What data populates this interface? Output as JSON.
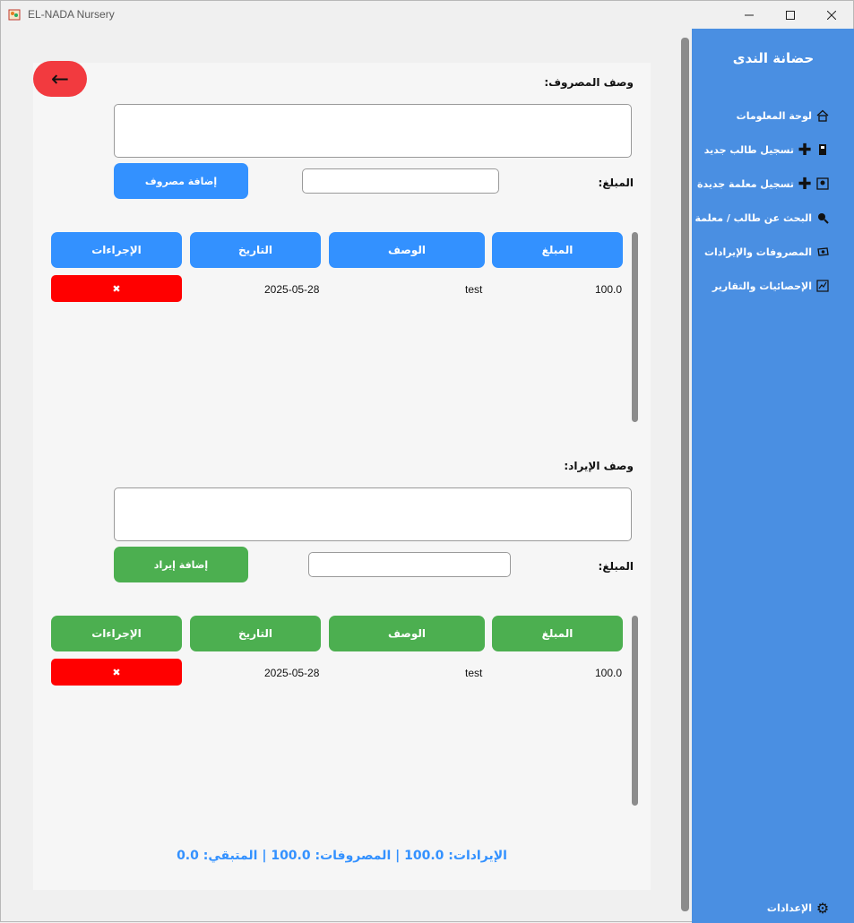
{
  "window": {
    "title": "EL-NADA Nursery"
  },
  "sidebar": {
    "title": "حضانة الندى",
    "items": [
      {
        "label": "لوحة المعلومات",
        "icon": "house-icon"
      },
      {
        "label": "تسجيل طالب جديد",
        "icon": "plus-icon"
      },
      {
        "label": "تسجيل معلمة جديدة",
        "icon": "plus-icon"
      },
      {
        "label": "البحث عن طالب / معلمة",
        "icon": "search-icon"
      },
      {
        "label": "المصروفات والإيرادات",
        "icon": "money-icon"
      },
      {
        "label": "الإحصائيات والتقارير",
        "icon": "chart-icon"
      }
    ],
    "settings_label": "الإعدادات"
  },
  "back_button": {
    "label": "←"
  },
  "expenses": {
    "desc_label": "وصف المصروف:",
    "amount_label": "المبلغ:",
    "add_button": "إضافة مصروف",
    "columns": [
      "المبلغ",
      "الوصف",
      "التاريخ",
      "الإجراءات"
    ],
    "rows": [
      {
        "amount": "100.0",
        "description": "test",
        "date": "2025-05-28",
        "delete": "✖"
      }
    ]
  },
  "income": {
    "desc_label": "وصف الإيراد:",
    "amount_label": "المبلغ:",
    "add_button": "إضافة إيراد",
    "columns": [
      "المبلغ",
      "الوصف",
      "التاريخ",
      "الإجراءات"
    ],
    "rows": [
      {
        "amount": "100.0",
        "description": "test",
        "date": "2025-05-28",
        "delete": "✖"
      }
    ]
  },
  "summary": "الإيرادات: 100.0 | المصروفات: 100.0 | المتبقي: 0.0",
  "colors": {
    "sidebar": "#4a8fe2",
    "expense_accent": "#3391ff",
    "income_accent": "#4caf50",
    "delete": "#ff0000",
    "back": "#f23a3f"
  }
}
